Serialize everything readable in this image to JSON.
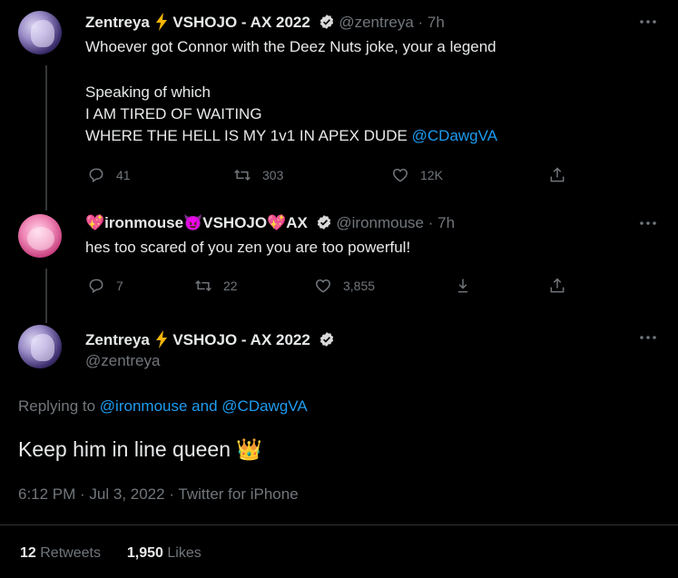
{
  "tweet1": {
    "display_name": "Zentreya",
    "badge_text": "VSHOJO - AX 2022",
    "handle": "@zentreya",
    "separator": "·",
    "time": "7h",
    "lines": [
      "Whoever got Connor with the Deez Nuts joke, your a legend",
      "",
      "Speaking of which",
      "I AM TIRED OF WAITING",
      "WHERE THE HELL IS MY 1v1 IN APEX DUDE"
    ],
    "mention": "@CDawgVA",
    "replies": "41",
    "retweets": "303",
    "likes": "12K"
  },
  "tweet2": {
    "heart_emoji": "💖",
    "name_part1": "ironmouse",
    "devil_emoji": "😈",
    "name_part2": "VSHOJO",
    "heart_emoji2": "💖",
    "name_part3": "AX",
    "handle": "@ironmouse",
    "separator": "·",
    "time": "7h",
    "text": "hes too scared of you zen you are too powerful!",
    "replies": "7",
    "retweets": "22",
    "likes": "3,855"
  },
  "main": {
    "display_name": "Zentreya",
    "badge_text": "VSHOJO - AX 2022",
    "handle": "@zentreya",
    "replying_prefix": "Replying to",
    "replying_user1": "@ironmouse",
    "replying_and": "and",
    "replying_user2": "@CDawgVA",
    "text": "Keep him in line queen",
    "crown_emoji": "👑",
    "timestamp": "6:12 PM · Jul 3, 2022 · Twitter for iPhone",
    "retweet_count": "12",
    "retweet_label": "Retweets",
    "like_count": "1,950",
    "like_label": "Likes"
  },
  "colors": {
    "background": "#000000",
    "text": "#e7e9ea",
    "muted": "#71767b",
    "link": "#1d9bf0",
    "bolt": "#f5b50a"
  }
}
